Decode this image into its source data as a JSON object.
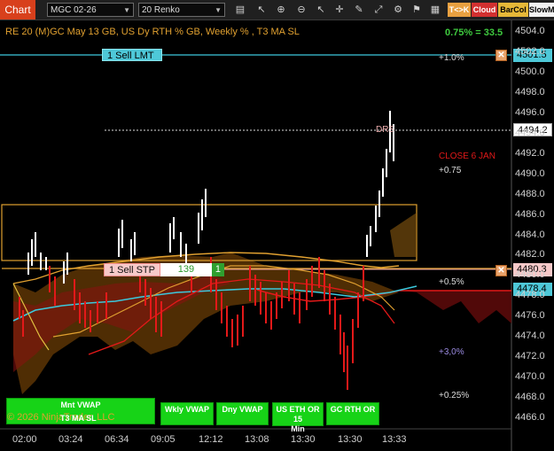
{
  "toolbar": {
    "chart_label": "Chart",
    "instrument": "MGC 02-26",
    "bar_type": "20 Renko",
    "icons": [
      "bars-icon",
      "pointer-icon",
      "zoom-in-icon",
      "zoom-out-icon",
      "cursor-icon",
      "crosshair-icon",
      "text-icon",
      "drawing-tools-icon",
      "properties-icon",
      "strategies-icon",
      "data-box-icon",
      "sync-icon"
    ],
    "buttons": {
      "tk": "T<>K",
      "cloud": "Cloud",
      "barcol": "BarCol",
      "slowm": "SlowM"
    },
    "colors": {
      "tk_bg": "#e8a040",
      "cloud_bg": "#d23030",
      "barcol_bg": "#e6b838",
      "slowm_bg": "#f2f2f2"
    }
  },
  "chart": {
    "title": "RE 20  (M)GC May 13 GB, US Dy RTH % GB, Weekly % , T3 MA SL",
    "change": "0.75% = 33.5",
    "price_ticks": [
      "4504.0",
      "4502.0",
      "4500.0",
      "4498.0",
      "4496.0",
      "4494.0",
      "4492.0",
      "4490.0",
      "4488.0",
      "4486.0",
      "4484.0",
      "4482.0",
      "4480.0",
      "4478.0",
      "4476.0",
      "4474.0",
      "4472.0",
      "4470.0",
      "4468.0",
      "4466.0"
    ],
    "time_ticks": [
      "02:00",
      "03:24",
      "06:34",
      "09:05",
      "12:12",
      "13:08",
      "13:30",
      "13:30",
      "13:33"
    ],
    "current_price": "4494.2",
    "sell_limit": {
      "label": "1 Sell LMT",
      "price": "4501.5"
    },
    "sell_stop": {
      "label": "1 Sell STP",
      "qty": "139",
      "count": "1",
      "price": "4480.3"
    },
    "level_4478": "4478.4",
    "annotations": {
      "plus_1": "+1.0%",
      "close_jan": "CLOSE 6 JAN",
      "plus_075": "+0.75",
      "plus_05": "+0.5%",
      "plus_3": "+3,0%",
      "plus_025": "+0.25%",
      "drs": "DRS"
    },
    "colors": {
      "up_bar": "#ffffff",
      "down_bar": "#e31919",
      "cloud": "#8a4a00",
      "cyan": "#3cc8dc",
      "orange": "#e0a030"
    }
  },
  "bottom_buttons": [
    {
      "line1": "Mnt VWAP",
      "line2": ""
    },
    {
      "line1": "Wkly VWAP",
      "line2": ""
    },
    {
      "line1": "Dny VWAP",
      "line2": ""
    },
    {
      "line1": "US ETH OR 15",
      "line2": "Min"
    },
    {
      "line1": "GC RTH OR",
      "line2": ""
    }
  ],
  "bottom_overlay": {
    "ma_label": "T3 MA SL",
    "copyright": "© 2026 NinjaTrader, LLC"
  }
}
